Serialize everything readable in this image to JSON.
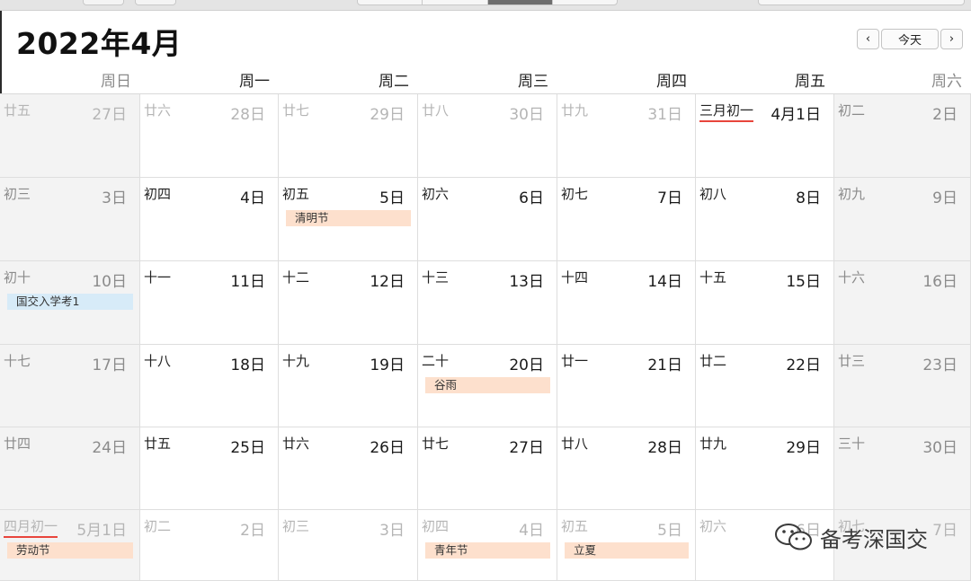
{
  "calendar": {
    "title": "2022年4月",
    "nav": {
      "prev": "‹",
      "today": "今天",
      "next": "›"
    },
    "weekdays": [
      "周日",
      "周一",
      "周二",
      "周三",
      "周四",
      "周五",
      "周六"
    ],
    "weeks": [
      [
        {
          "lunar": "廿五",
          "day": "27日",
          "dim": true
        },
        {
          "lunar": "廿六",
          "day": "28日",
          "dim": true
        },
        {
          "lunar": "廿七",
          "day": "29日",
          "dim": true
        },
        {
          "lunar": "廿八",
          "day": "30日",
          "dim": true
        },
        {
          "lunar": "廿九",
          "day": "31日",
          "dim": true
        },
        {
          "lunar": "三月初一",
          "day": "4月1日",
          "first": true
        },
        {
          "lunar": "初二",
          "day": "2日"
        }
      ],
      [
        {
          "lunar": "初三",
          "day": "3日"
        },
        {
          "lunar": "初四",
          "day": "4日"
        },
        {
          "lunar": "初五",
          "day": "5日",
          "event": {
            "label": "清明节",
            "kind": "holiday"
          }
        },
        {
          "lunar": "初六",
          "day": "6日"
        },
        {
          "lunar": "初七",
          "day": "7日"
        },
        {
          "lunar": "初八",
          "day": "8日"
        },
        {
          "lunar": "初九",
          "day": "9日"
        }
      ],
      [
        {
          "lunar": "初十",
          "day": "10日",
          "event": {
            "label": "国交入学考1",
            "kind": "personal"
          }
        },
        {
          "lunar": "十一",
          "day": "11日"
        },
        {
          "lunar": "十二",
          "day": "12日"
        },
        {
          "lunar": "十三",
          "day": "13日"
        },
        {
          "lunar": "十四",
          "day": "14日"
        },
        {
          "lunar": "十五",
          "day": "15日"
        },
        {
          "lunar": "十六",
          "day": "16日"
        }
      ],
      [
        {
          "lunar": "十七",
          "day": "17日"
        },
        {
          "lunar": "十八",
          "day": "18日"
        },
        {
          "lunar": "十九",
          "day": "19日"
        },
        {
          "lunar": "二十",
          "day": "20日",
          "event": {
            "label": "谷雨",
            "kind": "holiday"
          }
        },
        {
          "lunar": "廿一",
          "day": "21日"
        },
        {
          "lunar": "廿二",
          "day": "22日"
        },
        {
          "lunar": "廿三",
          "day": "23日"
        }
      ],
      [
        {
          "lunar": "廿四",
          "day": "24日"
        },
        {
          "lunar": "廿五",
          "day": "25日"
        },
        {
          "lunar": "廿六",
          "day": "26日"
        },
        {
          "lunar": "廿七",
          "day": "27日"
        },
        {
          "lunar": "廿八",
          "day": "28日"
        },
        {
          "lunar": "廿九",
          "day": "29日"
        },
        {
          "lunar": "三十",
          "day": "30日"
        }
      ],
      [
        {
          "lunar": "四月初一",
          "day": "5月1日",
          "dim": true,
          "first": true,
          "event": {
            "label": "劳动节",
            "kind": "holiday"
          }
        },
        {
          "lunar": "初二",
          "day": "2日",
          "dim": true
        },
        {
          "lunar": "初三",
          "day": "3日",
          "dim": true
        },
        {
          "lunar": "初四",
          "day": "4日",
          "dim": true,
          "event": {
            "label": "青年节",
            "kind": "holiday"
          }
        },
        {
          "lunar": "初五",
          "day": "5日",
          "dim": true,
          "event": {
            "label": "立夏",
            "kind": "holiday"
          }
        },
        {
          "lunar": "初六",
          "day": "6日",
          "dim": true
        },
        {
          "lunar": "初七",
          "day": "7日",
          "dim": true
        }
      ]
    ]
  },
  "watermark": {
    "text": "备考深国交",
    "icon": "wechat-icon"
  },
  "colors": {
    "holiday_bg": "#fde0cd",
    "personal_bg": "#d7ebf8",
    "first_day_underline": "#e8453c",
    "weekend_bg": "#f3f3f3"
  }
}
